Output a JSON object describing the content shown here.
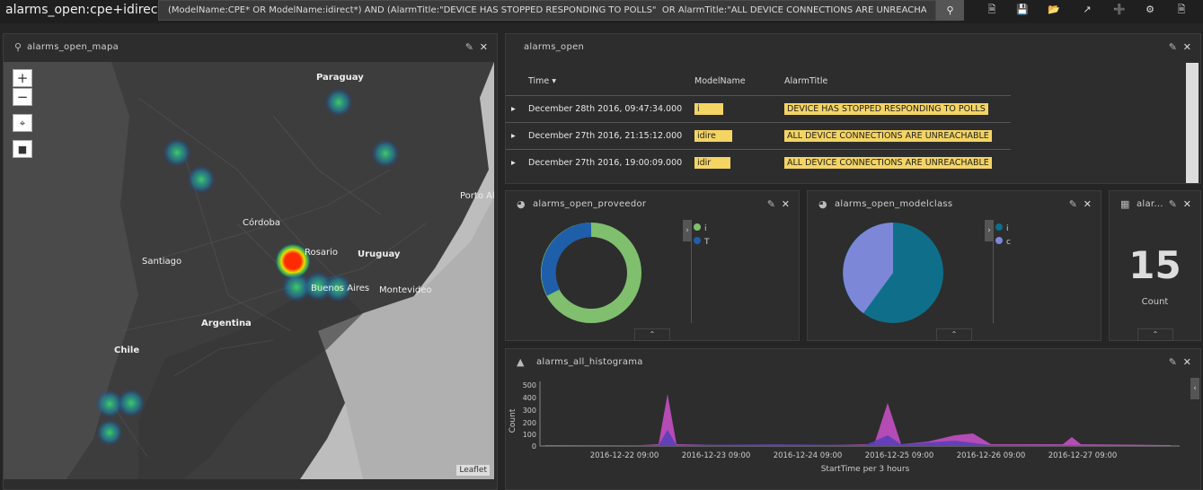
{
  "app": {
    "title": "alarms_open:cpe+idirect",
    "query": "(ModelName:CPE* OR ModelName:idirect*) AND (AlarmTitle:\"DEVICE HAS STOPPED RESPONDING TO POLLS\"  OR AlarmTitle:\"ALL DEVICE CONNECTIONS ARE UNREACHA"
  },
  "toolbar": {
    "search_icon": "search-icon",
    "icons": [
      "new-doc-icon",
      "save-icon",
      "open-folder-icon",
      "share-icon",
      "add-icon",
      "gear-icon",
      "doc-icon"
    ]
  },
  "map_panel": {
    "title": "alarms_open_mapa",
    "attribution": "Leaflet",
    "labels": {
      "paraguay": "Paraguay",
      "cordoba": "Córdoba",
      "rosario": "Rosario",
      "uruguay": "Uruguay",
      "santiago": "Santiago",
      "buenosaires": "Buenos Aires",
      "montevideo": "Montevideo",
      "argentina": "Argentina",
      "chile": "Chile",
      "portoalegre": "Porto Ale"
    },
    "zoom_in": "+",
    "zoom_out": "−"
  },
  "table_panel": {
    "title": "alarms_open",
    "columns": [
      "Time",
      "ModelName",
      "AlarmTitle"
    ],
    "rows": [
      {
        "time": "December 28th 2016, 09:47:34.000",
        "model": "i",
        "title": "DEVICE HAS STOPPED RESPONDING TO POLLS"
      },
      {
        "time": "December 27th 2016, 21:15:12.000",
        "model": "idire",
        "title": "ALL DEVICE CONNECTIONS ARE UNREACHABLE"
      },
      {
        "time": "December 27th 2016, 19:00:09.000",
        "model": "idir",
        "title": "ALL DEVICE CONNECTIONS ARE UNREACHABLE"
      }
    ]
  },
  "proveedor_panel": {
    "title": "alarms_open_proveedor",
    "legend": [
      "i",
      "T"
    ],
    "colors": [
      "#7fbf6e",
      "#1f5faa"
    ]
  },
  "modelclass_panel": {
    "title": "alarms_open_modelclass",
    "legend": [
      "i",
      "c"
    ],
    "colors": [
      "#0f6f8a",
      "#7d87d8"
    ]
  },
  "count_panel": {
    "title": "alar...",
    "value": "15",
    "label": "Count"
  },
  "histogram_panel": {
    "title": "alarms_all_histograma",
    "ylabel": "Count",
    "xlabel": "StartTime per 3 hours",
    "yticks": [
      "500",
      "400",
      "300",
      "200",
      "100",
      "0"
    ],
    "xticks": [
      "2016-12-22 09:00",
      "2016-12-23 09:00",
      "2016-12-24 09:00",
      "2016-12-25 09:00",
      "2016-12-26 09:00",
      "2016-12-27 09:00"
    ]
  }
}
